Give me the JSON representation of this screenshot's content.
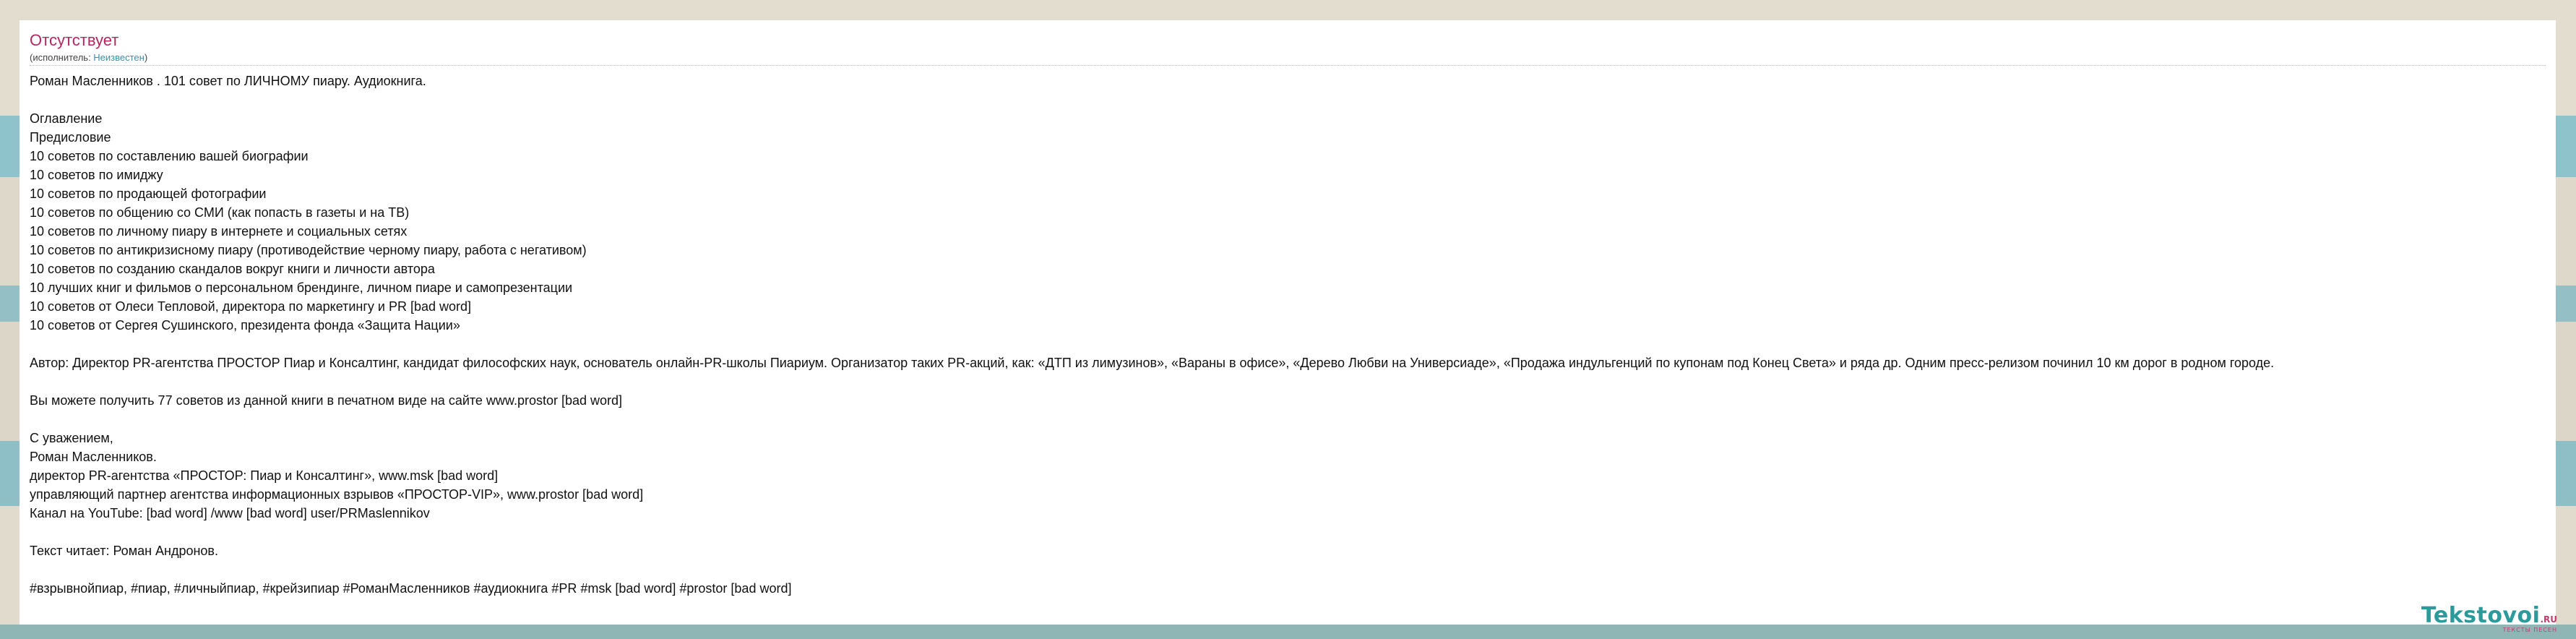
{
  "song": {
    "title": "Отсутствует",
    "performer_prefix": "(исполнитель: ",
    "performer_name": "Неизвестен",
    "performer_suffix": ")"
  },
  "lyrics": [
    "Роман Масленников . 101 совет по ЛИЧНОМУ пиару. Аудиокнига.",
    "",
    "Оглавление",
    "Предисловие",
    "10 советов по составлению вашей биографии",
    "10 советов по имиджу",
    "10 советов по продающей фотографии",
    "10 советов по общению со СМИ (как попасть в газеты и на ТВ)",
    "10  советов по личному пиару в интернете и социальных сетях",
    "10 советов по антикризисному пиару (противодействие черному пиару, работа с негативом)",
    "10 советов по созданию скандалов вокруг книги и личности автора",
    "10 лучших книг и фильмов о персональном брендинге, личном пиаре и самопрезентации",
    "10 советов от Олеси Тепловой, директора по маркетингу и PR [bad word]",
    "10 советов от Сергея Сушинского, президента фонда «Защита Нации»",
    "",
    "Автор: Директор PR-агентства ПРОСТОР Пиар и Консалтинг, кандидат философских наук, основатель онлайн-PR-школы Пиариум. Организатор таких PR-акций, как: «ДТП из лимузинов», «Вараны в офисе», «Дерево Любви на Универсиаде», «Продажа индульгенций по купонам под Конец Света» и ряда др. Одним пресс-релизом починил 10 км дорог в родном городе.",
    "",
    "Вы можете получить 77 советов из данной книги в печатном виде на сайте www.prostor [bad word]",
    "",
    "С уважением,",
    "Роман Масленников.",
    "директор PR-агентства «ПРОСТОР: Пиар и Консалтинг», www.msk [bad word]",
    "управляющий партнер агентства информационных взрывов «ПРОСТОР-VIP», www.prostor [bad word]",
    "Канал на YouTube: [bad word] /www [bad word] user/PRMaslennikov",
    "",
    "Текст читает: Роман Андронов.",
    "",
    "#взрывнойпиар, #пиар, #личныйпиар, #крейзипиар #РоманМасленников #аудиокнига #PR #msk [bad word] #prostor [bad word]"
  ],
  "logo": {
    "main": "Tekstovoi",
    "suffix": ".RU",
    "tagline": "ТЕКСТЫ ПЕСЕН"
  },
  "colors": {
    "title": "#b3275f",
    "link": "#3d8fa8",
    "logo_main": "#2a9a9a",
    "logo_accent": "#c13e6c"
  }
}
